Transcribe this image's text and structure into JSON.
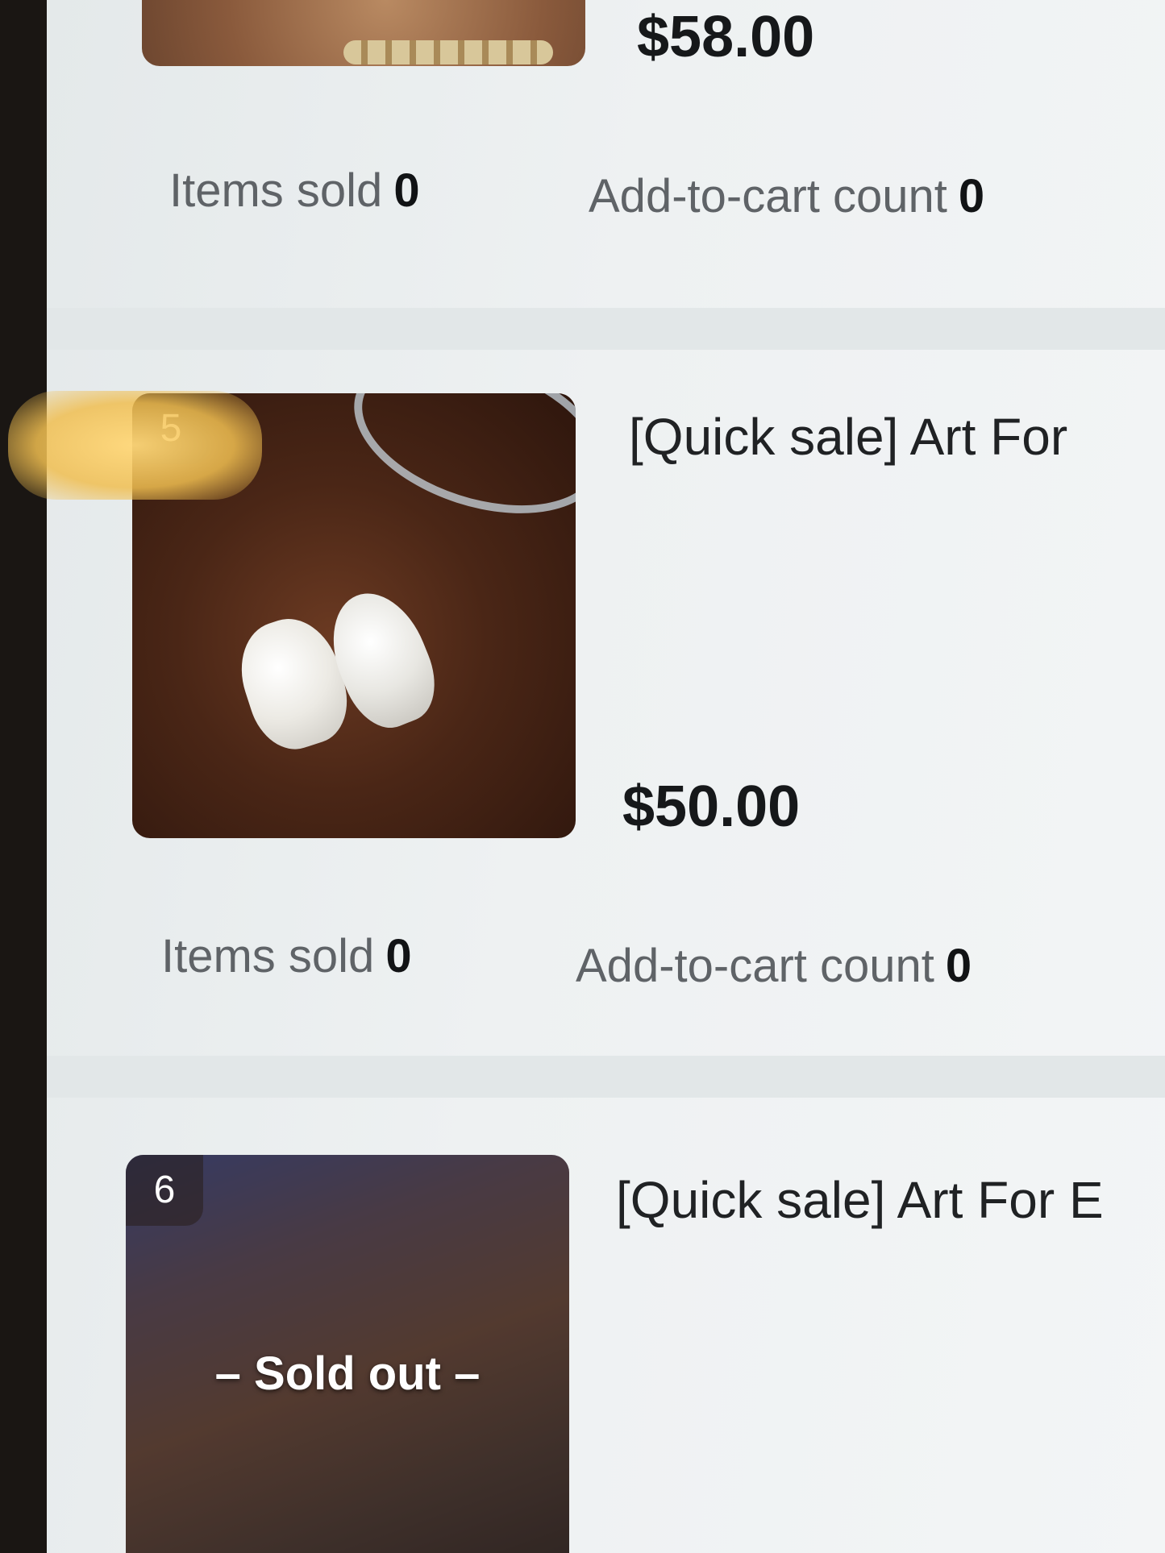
{
  "products": [
    {
      "index": "",
      "title": "",
      "price": "$58.00",
      "sold_label": "Items sold",
      "sold_value": "0",
      "cart_label": "Add-to-cart count",
      "cart_value": "0",
      "overlay": ""
    },
    {
      "index": "5",
      "title": "[Quick sale] Art For",
      "price": "$50.00",
      "sold_label": "Items sold",
      "sold_value": "0",
      "cart_label": "Add-to-cart count",
      "cart_value": "0",
      "overlay": ""
    },
    {
      "index": "6",
      "title": "[Quick sale] Art For E",
      "price": "",
      "sold_label": "",
      "sold_value": "",
      "cart_label": "",
      "cart_value": "",
      "overlay": "– Sold out –"
    }
  ]
}
